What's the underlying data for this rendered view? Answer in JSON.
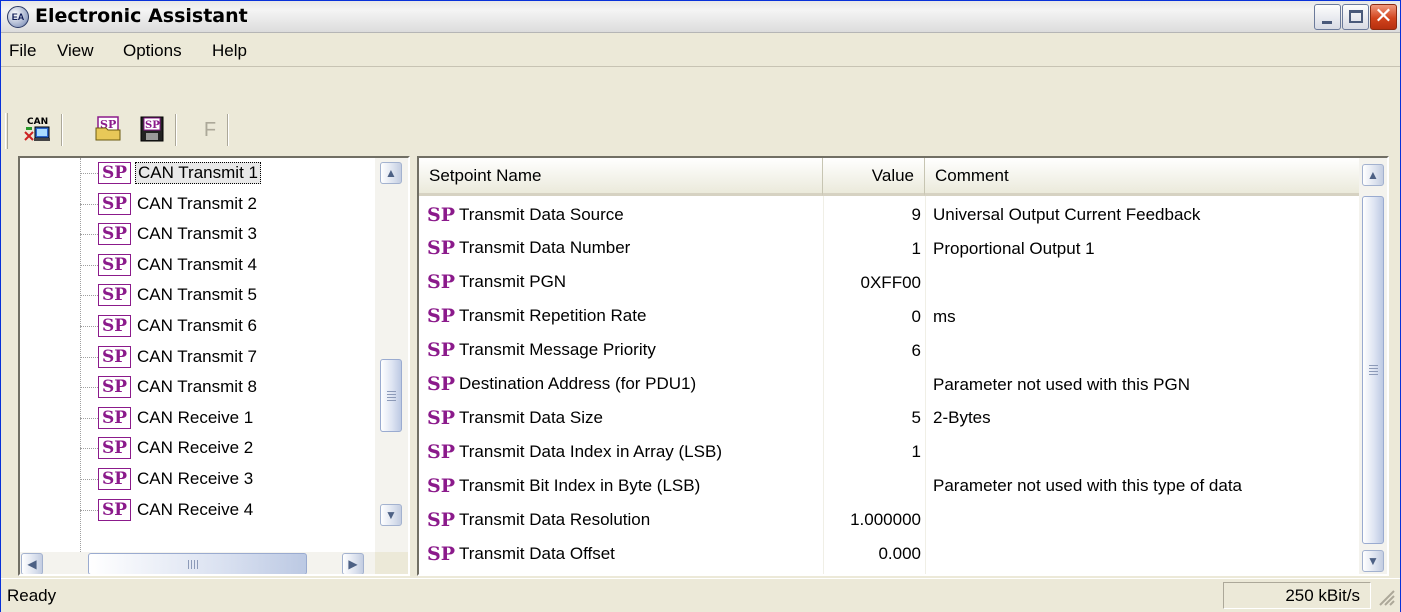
{
  "window": {
    "title": "Electronic Assistant",
    "icon": "EA",
    "close_glyph": "✕"
  },
  "menu": [
    "File",
    "View",
    "Options",
    "Help"
  ],
  "toolbar": {
    "can_icon_text": "CAN",
    "open_setpoint_label": "SP",
    "save_setpoint_label": "SP",
    "flash_label": "F"
  },
  "tree": {
    "items": [
      {
        "label": "CAN Transmit 1",
        "icon": "SP",
        "selected": true
      },
      {
        "label": "CAN Transmit 2",
        "icon": "SP"
      },
      {
        "label": "CAN Transmit 3",
        "icon": "SP"
      },
      {
        "label": "CAN Transmit 4",
        "icon": "SP"
      },
      {
        "label": "CAN Transmit 5",
        "icon": "SP"
      },
      {
        "label": "CAN Transmit 6",
        "icon": "SP"
      },
      {
        "label": "CAN Transmit 7",
        "icon": "SP"
      },
      {
        "label": "CAN Transmit 8",
        "icon": "SP"
      },
      {
        "label": "CAN Receive 1",
        "icon": "SP"
      },
      {
        "label": "CAN Receive 2",
        "icon": "SP"
      },
      {
        "label": "CAN Receive 3",
        "icon": "SP"
      },
      {
        "label": "CAN Receive 4",
        "icon": "SP"
      }
    ]
  },
  "table": {
    "headers": {
      "name": "Setpoint Name",
      "value": "Value",
      "comment": "Comment"
    },
    "row_icon": "SP",
    "rows": [
      {
        "name": "Transmit Data Source",
        "value": "9",
        "comment": "Universal Output Current Feedback"
      },
      {
        "name": "Transmit Data Number",
        "value": "1",
        "comment": "Proportional Output 1"
      },
      {
        "name": "Transmit PGN",
        "value": "0XFF00",
        "comment": ""
      },
      {
        "name": "Transmit Repetition Rate",
        "value": "0",
        "comment": "ms"
      },
      {
        "name": "Transmit Message Priority",
        "value": "6",
        "comment": ""
      },
      {
        "name": "Destination Address (for PDU1)",
        "value": "",
        "comment": "Parameter not used with this PGN"
      },
      {
        "name": "Transmit Data Size",
        "value": "5",
        "comment": "2-Bytes"
      },
      {
        "name": "Transmit Data Index in Array (LSB)",
        "value": "1",
        "comment": ""
      },
      {
        "name": "Transmit Bit Index in Byte (LSB)",
        "value": "",
        "comment": "Parameter not used with this type of data"
      },
      {
        "name": "Transmit Data Resolution",
        "value": "1.000000",
        "comment": ""
      },
      {
        "name": "Transmit Data Offset",
        "value": "0.000",
        "comment": ""
      }
    ]
  },
  "status": {
    "text": "Ready",
    "baud": "250 kBit/s"
  },
  "colors": {
    "sp_icon": "#8b1a8b",
    "close_button": "#d1441d",
    "frame": "#ece9d8"
  }
}
